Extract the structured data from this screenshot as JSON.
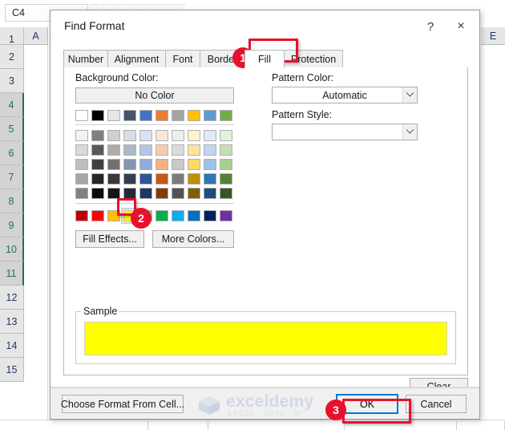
{
  "excel": {
    "name_box_value": "C4",
    "column_headers": [
      "A",
      "E"
    ],
    "row_headers": [
      "1",
      "2",
      "3",
      "4",
      "5",
      "6",
      "7",
      "8",
      "9",
      "10",
      "11",
      "12",
      "13",
      "14",
      "15"
    ],
    "selected_rows": [
      "4",
      "5",
      "6",
      "7",
      "8",
      "9",
      "10",
      "11"
    ],
    "selection_accent_color": "#217346",
    "bottom_row_cells": [
      "",
      "",
      "",
      "",
      ""
    ]
  },
  "dialog": {
    "title": "Find Format",
    "help_icon": "?",
    "close_icon": "×",
    "tabs": [
      {
        "label": "Number",
        "active": false
      },
      {
        "label": "Alignment",
        "active": false
      },
      {
        "label": "Font",
        "active": false
      },
      {
        "label": "Border",
        "active": false
      },
      {
        "label": "Fill",
        "active": true
      },
      {
        "label": "Protection",
        "active": false
      }
    ],
    "fill": {
      "background_color_label": "Background Color:",
      "background_color_label_accel": "C",
      "no_color_button": "No Color",
      "pattern_color_label": "Pattern Color:",
      "pattern_color_label_accel": "a",
      "pattern_color_value": "Automatic",
      "pattern_style_label": "Pattern Style:",
      "pattern_style_accel": "P",
      "pattern_style_value": "",
      "fill_effects_button": "Fill Effects...",
      "fill_effects_accel": "i",
      "more_colors_button": "More Colors...",
      "more_colors_accel": "M",
      "selected_swatch_color": "#FFFF00",
      "theme_colors_row": [
        "#FFFFFF",
        "#000000",
        "#E7E6E6",
        "#44546A",
        "#4472C4",
        "#ED7D31",
        "#A5A5A5",
        "#FFC000",
        "#5B9BD5",
        "#70AD47"
      ],
      "theme_tint_rows": [
        [
          "#F2F2F2",
          "#7F7F7F",
          "#D0CECE",
          "#D6DCE4",
          "#D9E2F3",
          "#FBE5D5",
          "#EDEDED",
          "#FFF2CC",
          "#DEEBF6",
          "#E2EFD9"
        ],
        [
          "#D9D9D9",
          "#595959",
          "#AEABAB",
          "#ACB9CA",
          "#B4C6E7",
          "#F7CBAC",
          "#DBDBDB",
          "#FFE599",
          "#BDD7EE",
          "#C5E0B3"
        ],
        [
          "#BFBFBF",
          "#3F3F3F",
          "#757070",
          "#8496B0",
          "#8FAADB",
          "#F4B183",
          "#C9C9C9",
          "#FFD965",
          "#9CC3E5",
          "#A8D08D"
        ],
        [
          "#A6A6A6",
          "#262626",
          "#3A3838",
          "#333F4F",
          "#2F5596",
          "#C45911",
          "#7B7B7B",
          "#BF8F00",
          "#2E75B5",
          "#548235"
        ],
        [
          "#808080",
          "#0C0C0C",
          "#171616",
          "#222A35",
          "#1F3763",
          "#833C00",
          "#525252",
          "#7F6000",
          "#1E4E79",
          "#375623"
        ]
      ],
      "standard_colors_row": [
        "#C00000",
        "#FF0000",
        "#FFC000",
        "#FFFF00",
        "#92D050",
        "#00B050",
        "#00B0F0",
        "#0070C0",
        "#002060",
        "#7030A0"
      ]
    },
    "sample_legend": "Sample",
    "sample_color": "#FFFF00",
    "clear_button": "Clear",
    "clear_accel": "r",
    "choose_format_button": "Choose Format From Cell...",
    "choose_format_accel": "a",
    "ok_button": "OK",
    "cancel_button": "Cancel"
  },
  "annotations": {
    "badges": [
      {
        "number": "1",
        "target": "fill-tab"
      },
      {
        "number": "2",
        "target": "yellow-swatch"
      },
      {
        "number": "3",
        "target": "ok-button"
      }
    ],
    "accent_color": "#e8112d"
  },
  "watermark": {
    "name": "exceldemy",
    "tagline": "EXCEL · DATA · BI"
  }
}
